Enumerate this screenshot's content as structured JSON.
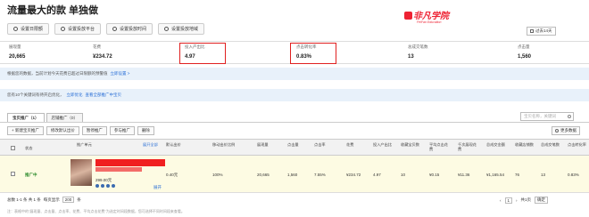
{
  "page": {
    "title": "流量最大的款 单独做"
  },
  "logo": {
    "cn": "非凡学院",
    "en": "FeiFan Education"
  },
  "toolbar": {
    "buttons": [
      "设置日限额",
      "设置投放平台",
      "设置投放时间",
      "设置投放地域"
    ]
  },
  "date_range": {
    "label": "过去14天"
  },
  "stats": [
    {
      "label": "展现量",
      "value": "20,665"
    },
    {
      "label": "花费",
      "value": "¥234.72"
    },
    {
      "label": "投入产出比",
      "value": "4.97"
    },
    {
      "label": "点击转化率",
      "value": "0.83%"
    },
    {
      "label": "总成交笔数",
      "value": "13"
    },
    {
      "label": "点击量",
      "value": "1,560"
    }
  ],
  "notices": [
    {
      "text": "根据您的数据，当前计划今天花费已超过日限额的预警值",
      "link": "立即设置 >"
    },
    {
      "text": "您有10个关键词有待开启优化，",
      "link1": "立即优化",
      "link2": "查看全部推广中宝贝"
    }
  ],
  "tabs": [
    "宝贝推广（1）",
    "店铺推广（0）"
  ],
  "search": {
    "placeholder": "宝贝名称，关键词"
  },
  "actions": [
    "+ 新建宝贝推广",
    "修改默认出价",
    "暂停推广",
    "参与推广",
    "删除"
  ],
  "more_data": "更多数据",
  "table": {
    "headers": [
      "状态",
      "推广单元",
      "展开全部",
      "默认出价",
      "移动出价比例",
      "展现量",
      "点击量",
      "点击率",
      "花费",
      "投入产出比",
      "收藏宝贝数",
      "平均点击花费",
      "千次展现花费",
      "总成交金额",
      "收藏店铺数",
      "总成交笔数",
      "点击转化率"
    ],
    "row": {
      "status": "推广中",
      "price": "299.00元",
      "expand": "展开",
      "default_bid": "0.40元",
      "mobile_ratio": "100%",
      "impressions": "20,665",
      "clicks": "1,560",
      "ctr": "7.55%",
      "cost": "¥234.72",
      "roi": "4.97",
      "fav_items": "10",
      "avg_cpc": "¥0.15",
      "cpm": "¥11.36",
      "gmv": "¥1,165.54",
      "fav_shops": "76",
      "orders": "13",
      "cvr": "0.83%"
    }
  },
  "pager": {
    "summary": "总数 1-1 条 共 1 条",
    "per_page_label": "每页显示",
    "per_page": "200",
    "unit": "条",
    "page_info": "共1页",
    "page_num": "1",
    "goto": "确定"
  },
  "footnote": "注：表格中的\"展现量、点击量、点击率、花费、平均点击花费\"为选定时间段数据，您可选择不同时间段来查看。"
}
